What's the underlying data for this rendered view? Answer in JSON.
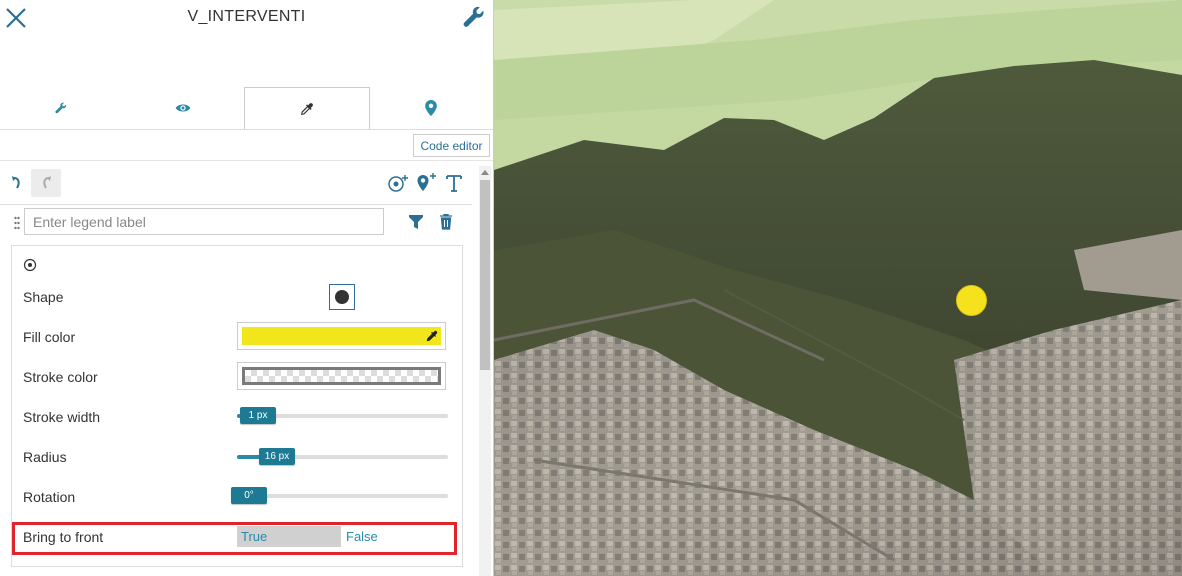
{
  "header": {
    "title": "V_INTERVENTI",
    "close_icon": "close-icon",
    "settings_icon": "wrench-icon"
  },
  "tabs": [
    {
      "icon": "wrench-icon",
      "active": false
    },
    {
      "icon": "eye-icon",
      "active": false
    },
    {
      "icon": "eyedropper-icon",
      "active": true
    },
    {
      "icon": "map-pin-icon",
      "active": false
    }
  ],
  "code_editor": {
    "label": "Code editor"
  },
  "toolbar": {
    "undo_icon": "undo-icon",
    "redo_icon": "redo-icon",
    "add_point_icon": "add-point-icon",
    "add_marker_icon": "add-marker-icon",
    "text_icon": "text-icon"
  },
  "legend": {
    "placeholder": "Enter legend label",
    "filter_icon": "filter-icon",
    "delete_icon": "trash-icon"
  },
  "style": {
    "symbol_icon": "point-symbol-icon",
    "shape": {
      "label": "Shape",
      "value": "circle"
    },
    "fill_color": {
      "label": "Fill color",
      "value": "#f1e51b"
    },
    "stroke_color": {
      "label": "Stroke color",
      "value": "transparent"
    },
    "stroke_width": {
      "label": "Stroke width",
      "value": "1 px",
      "level": 0.05
    },
    "radius": {
      "label": "Radius",
      "value": "16 px",
      "level": 0.16
    },
    "rotation": {
      "label": "Rotation",
      "value": "0°",
      "level": 0.0
    },
    "bring_to_front": {
      "label": "Bring to front",
      "true_label": "True",
      "false_label": "False",
      "selected": "True"
    }
  },
  "colors": {
    "accent": "#2b8aa8",
    "highlight_border": "#e0242b",
    "map_point": "#f6e21c"
  }
}
